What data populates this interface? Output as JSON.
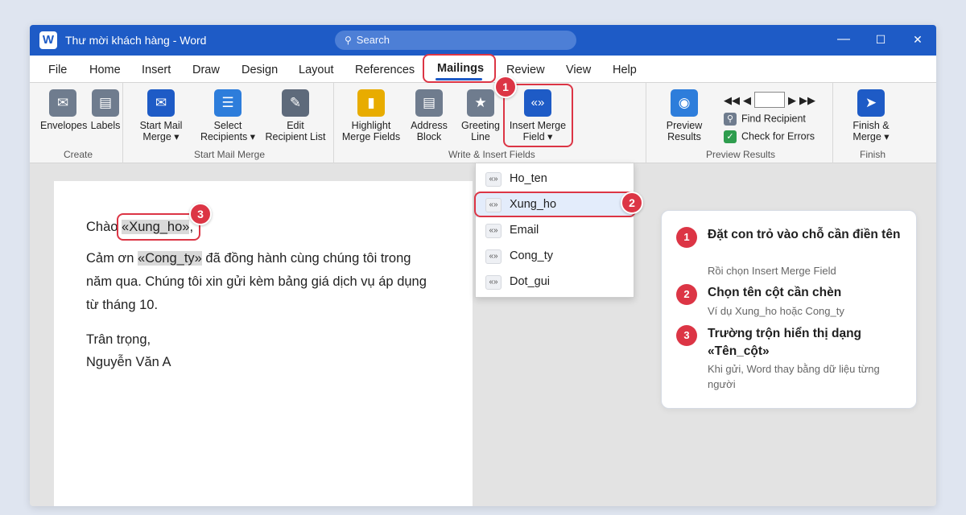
{
  "window": {
    "title": "Thư mời khách hàng - Word",
    "app_letter": "W",
    "search_placeholder": "Search",
    "controls": {
      "minimize": "—",
      "maximize": "☐",
      "close": "✕"
    }
  },
  "menu": [
    "File",
    "Home",
    "Insert",
    "Draw",
    "Design",
    "Layout",
    "References",
    "Mailings",
    "Review",
    "View",
    "Help"
  ],
  "ribbon": {
    "create": {
      "label": "Create",
      "envelopes": "Envelopes",
      "labels": "Labels"
    },
    "start": {
      "label": "Start Mail Merge",
      "start_l1": "Start Mail",
      "start_l2": "Merge ▾",
      "select_l1": "Select",
      "select_l2": "Recipients ▾",
      "edit_l1": "Edit",
      "edit_l2": "Recipient List"
    },
    "write": {
      "label": "Write & Insert Fields",
      "highlight_l1": "Highlight",
      "highlight_l2": "Merge Fields",
      "address_l1": "Address",
      "address_l2": "Block",
      "greeting_l1": "Greeting",
      "greeting_l2": "Line",
      "insert_l1": "Insert Merge",
      "insert_l2": "Field ▾"
    },
    "preview": {
      "label": "Preview Results",
      "preview_l1": "Preview",
      "preview_l2": "Results",
      "find": "Find Recipient",
      "check": "Check for Errors"
    },
    "finish": {
      "label": "Finish",
      "finish_l1": "Finish &",
      "finish_l2": "Merge ▾"
    }
  },
  "dropdown": [
    "Ho_ten",
    "Xung_ho",
    "Email",
    "Cong_ty",
    "Dot_gui"
  ],
  "document": {
    "greet_prefix": "Chào ",
    "field_xung_ho": "«Xung_ho»",
    "greet_suffix": ",",
    "p1_prefix": "Cảm ơn ",
    "field_cong_ty": "«Cong_ty»",
    "p1_rest": " đã đồng hành cùng chúng tôi trong",
    "p1_line2": "năm qua. Chúng tôi xin gửi kèm bảng giá dịch vụ áp dụng",
    "p1_line3": "từ tháng 10.",
    "closing": "Trân trọng,",
    "signature": "Nguyễn Văn A"
  },
  "steps": [
    {
      "num": "1",
      "title": "Đặt con trỏ vào chỗ cần điền tên",
      "sub": "Rồi chọn Insert Merge Field"
    },
    {
      "num": "2",
      "title": "Chọn tên cột cần chèn",
      "sub": "Ví dụ Xung_ho hoặc Cong_ty"
    },
    {
      "num": "3",
      "title": "Trường trộn hiển thị dạng «Tên_cột»",
      "sub": "Khi gửi, Word thay bằng dữ liệu từng người"
    }
  ],
  "colors": {
    "accent": "#1e5bc6",
    "highlight": "#dc3545"
  }
}
